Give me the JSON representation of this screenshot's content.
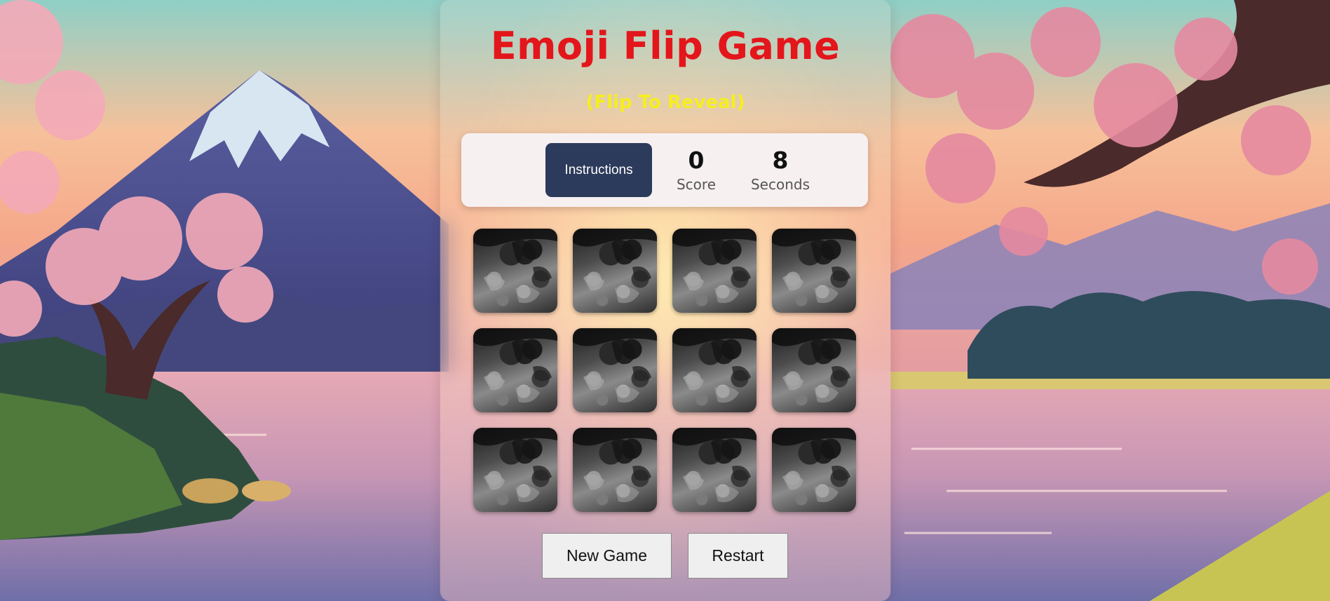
{
  "game": {
    "title": "Emoji Flip Game",
    "subtitle": "(Flip To Reveal)"
  },
  "status": {
    "instructions_label": "Instructions",
    "score_value": "0",
    "score_label": "Score",
    "time_value": "8",
    "time_label": "Seconds"
  },
  "board": {
    "rows": 3,
    "columns": 4,
    "cards": [
      {
        "state": "face-down"
      },
      {
        "state": "face-down"
      },
      {
        "state": "face-down"
      },
      {
        "state": "face-down"
      },
      {
        "state": "face-down"
      },
      {
        "state": "face-down"
      },
      {
        "state": "face-down"
      },
      {
        "state": "face-down"
      },
      {
        "state": "face-down"
      },
      {
        "state": "face-down"
      },
      {
        "state": "face-down"
      },
      {
        "state": "face-down"
      }
    ]
  },
  "controls": {
    "new_game_label": "New Game",
    "restart_label": "Restart"
  },
  "colors": {
    "title": "#e3161b",
    "subtitle": "#f6ee1f",
    "instructions_button": "#2c3a5b",
    "status_bar": "#f6f0f1"
  }
}
